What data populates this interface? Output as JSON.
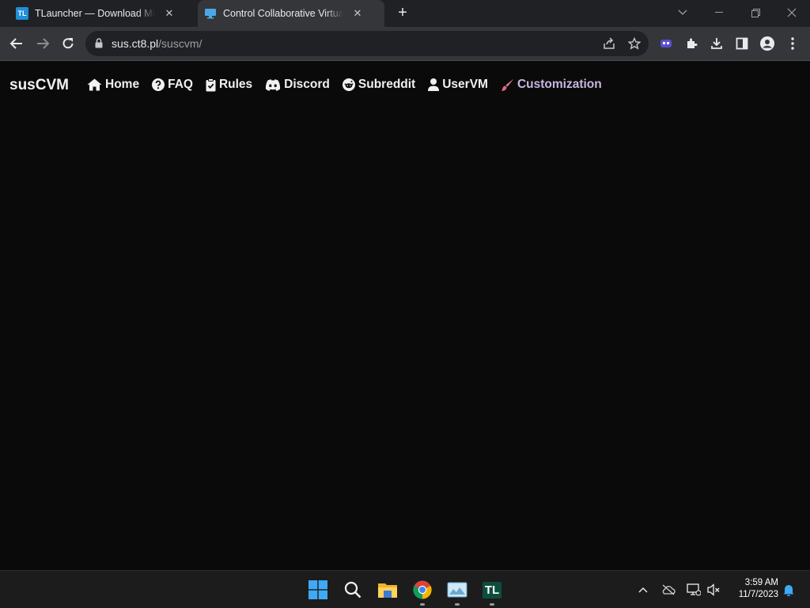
{
  "browser": {
    "tabs": [
      {
        "title": "TLauncher — Download Minecraft",
        "icon": "tlauncher-icon",
        "active": false
      },
      {
        "title": "Control Collaborative Virtual Machines",
        "icon": "monitor-icon",
        "active": true
      }
    ],
    "new_tab_label": "+",
    "url_host": "sus.ct8.pl",
    "url_path": "/suscvm/"
  },
  "site": {
    "brand": "susCVM",
    "nav": [
      {
        "label": "Home",
        "icon": "home-icon"
      },
      {
        "label": "FAQ",
        "icon": "question-icon"
      },
      {
        "label": "Rules",
        "icon": "clipboard-icon"
      },
      {
        "label": "Discord",
        "icon": "discord-icon"
      },
      {
        "label": "Subreddit",
        "icon": "reddit-icon"
      },
      {
        "label": "UserVM",
        "icon": "user-icon"
      },
      {
        "label": "Customization",
        "icon": "paintbrush-icon"
      }
    ]
  },
  "taskbar": {
    "time": "3:59 AM",
    "date": "11/7/2023",
    "tl_label": "TL"
  },
  "colors": {
    "page_bg": "#0a0a0a",
    "customization_accent": "#c8b7df",
    "chrome_toolbar": "#35363a",
    "chrome_titlebar": "#202124"
  }
}
